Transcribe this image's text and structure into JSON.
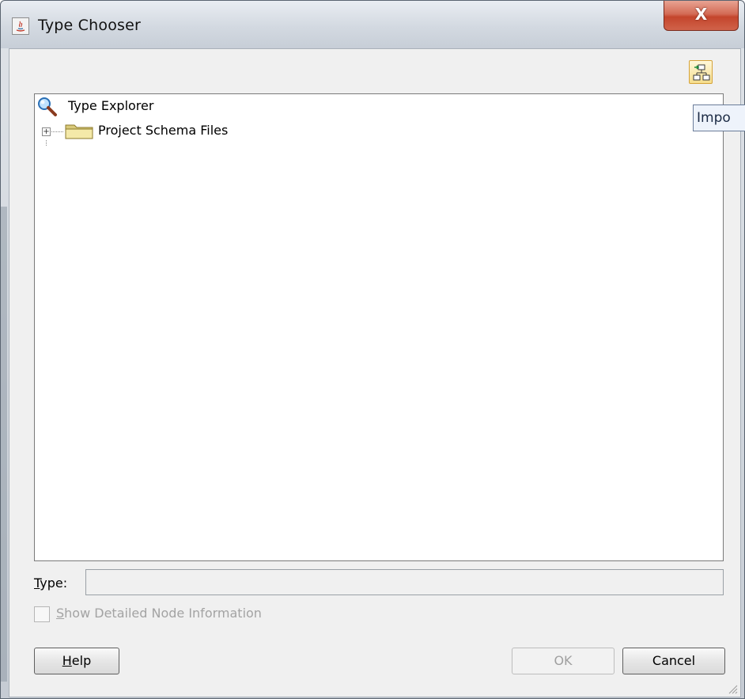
{
  "window": {
    "title": "Type Chooser",
    "close_label": "X"
  },
  "toolbar": {
    "import_tooltip": "Impo"
  },
  "tree": {
    "root_label": "Type Explorer",
    "children": [
      {
        "label": "Project Schema Files",
        "expander": "+"
      }
    ]
  },
  "type_field": {
    "label_mnemonic": "T",
    "label_rest": "ype:",
    "value": ""
  },
  "detail_checkbox": {
    "label_mnemonic": "S",
    "label_rest": "how Detailed Node Information",
    "checked": false,
    "enabled": false
  },
  "buttons": {
    "help_mnemonic": "H",
    "help_rest": "elp",
    "ok_label": "OK",
    "cancel_label": "Cancel"
  },
  "colors": {
    "close_red": "#c4452c",
    "import_accent": "#f6de8c",
    "tooltip_bg": "#eef3fb"
  },
  "icons": {
    "title": "java-app-icon",
    "import": "import-schema-icon",
    "root": "magnifier-icon",
    "folder": "folder-icon"
  }
}
